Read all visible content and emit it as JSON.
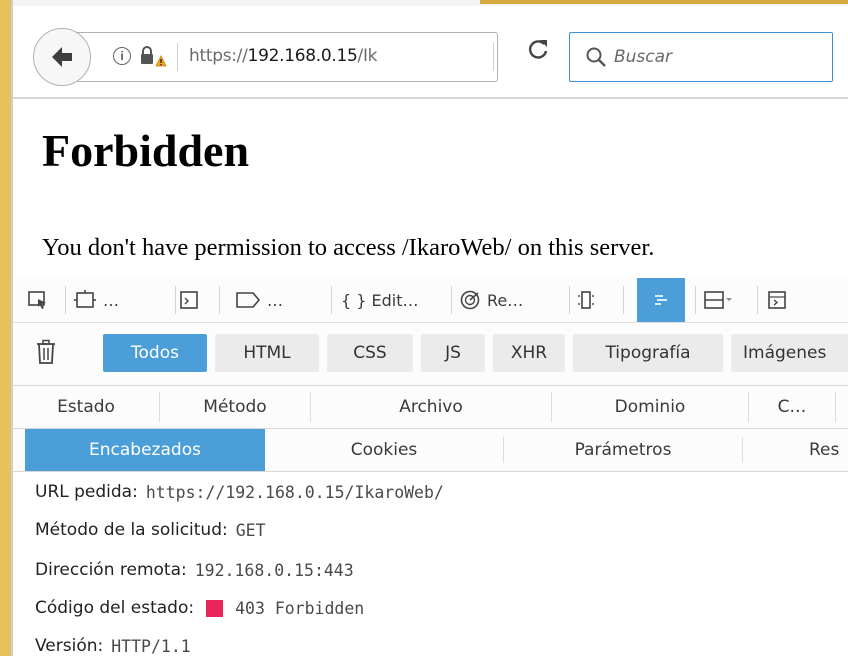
{
  "browser": {
    "url_prefix": "https://",
    "url_host": "192.168.0.15",
    "url_rest": "/Ik",
    "search_placeholder": "Buscar"
  },
  "page": {
    "title": "Forbidden",
    "message": "You don't have permission to access /IkaroWeb/ on this server."
  },
  "devtools": {
    "toolbar": [
      {
        "name": "pick-element",
        "label": ""
      },
      {
        "name": "responsive-design",
        "label": "…"
      },
      {
        "name": "console",
        "label": ""
      },
      {
        "name": "scratchpad",
        "label": "…"
      },
      {
        "name": "style-editor",
        "label": "{ } Edit…"
      },
      {
        "name": "performance",
        "label": "Re…"
      },
      {
        "name": "memory",
        "label": ""
      },
      {
        "name": "network",
        "label": ""
      },
      {
        "name": "layout",
        "label": ""
      },
      {
        "name": "console-2",
        "label": ""
      }
    ],
    "filters": [
      "Todos",
      "HTML",
      "CSS",
      "JS",
      "XHR",
      "Tipografía",
      "Imágenes"
    ],
    "active_filter": "Todos",
    "columns": [
      "Estado",
      "Método",
      "Archivo",
      "Dominio",
      "C…"
    ],
    "tabs": [
      "Encabezados",
      "Cookies",
      "Parámetros",
      "Res"
    ],
    "active_tab": "Encabezados",
    "headers": [
      {
        "label": "URL pedida:",
        "value": "https://192.168.0.15/IkaroWeb/"
      },
      {
        "label": "Método de la solicitud:",
        "value": "GET"
      },
      {
        "label": "Dirección remota:",
        "value": "192.168.0.15:443"
      },
      {
        "label": "Código del estado:",
        "value": "403 Forbidden"
      },
      {
        "label": "Versión:",
        "value": "HTTP/1.1"
      }
    ],
    "status_color": "#e8245a",
    "accent_color": "#4c9ed9"
  }
}
